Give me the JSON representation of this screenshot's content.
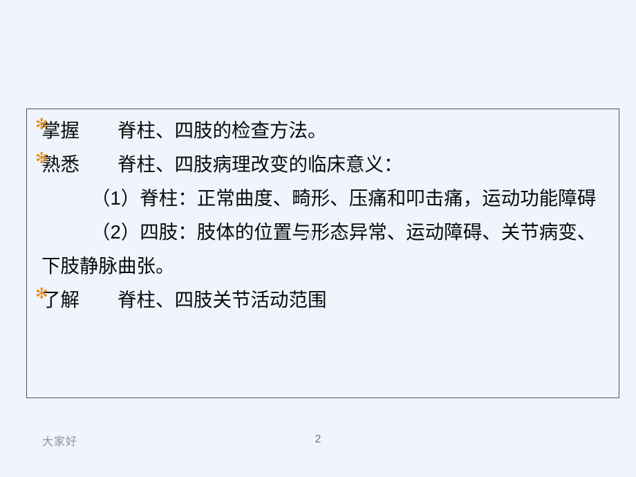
{
  "slide": {
    "background_color": "#eff4fd",
    "box_border_color": "#4a5564",
    "bullet_color": "#e79022",
    "text_color": "#0a0a0a",
    "bullet_glyph": "✻",
    "bullets": [
      {
        "marker": "✻",
        "text": "掌握　　脊柱、四肢的检查方法。"
      },
      {
        "marker": "✻",
        "text": "熟悉　　脊柱、四肢病理改变的临床意义："
      }
    ],
    "sub_items": [
      {
        "text": "（1）脊柱：正常曲度、畸形、压痛和叩击痛，运动功能障碍"
      },
      {
        "text": "（2）四肢：肢体的位置与形态异常、运动障碍、关节病变、下肢静脉曲张。"
      }
    ],
    "last_bullet": {
      "marker": "✻",
      "text": "了解　　脊柱、四肢关节活动范围"
    }
  },
  "footer": {
    "note": "大家好",
    "page_number": "2"
  }
}
